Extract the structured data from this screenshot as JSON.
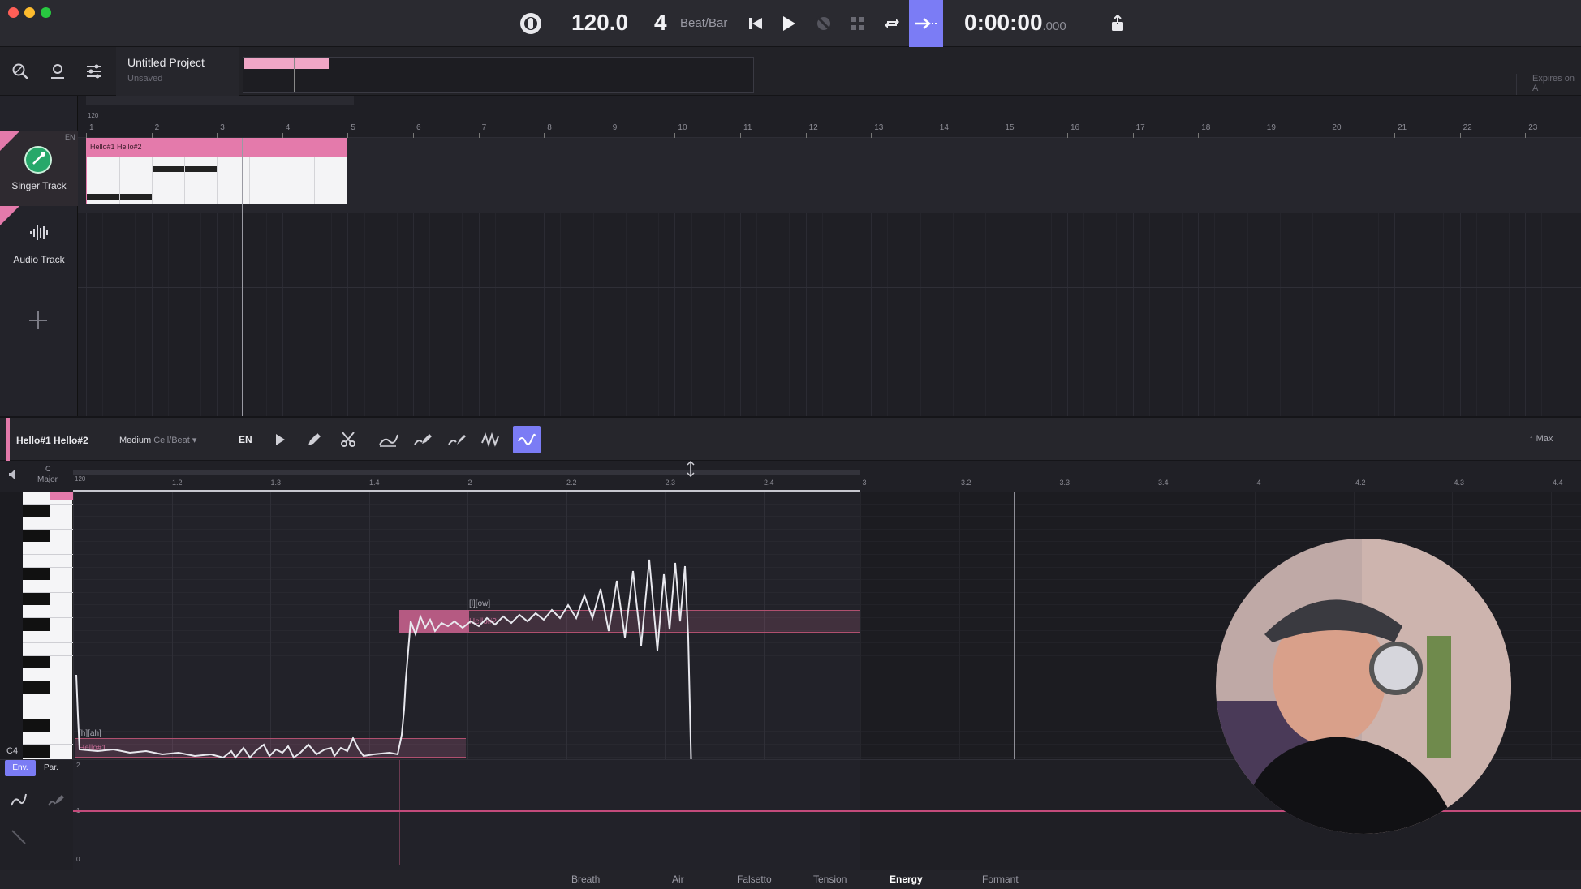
{
  "window": {
    "traffic_colors": [
      "#ff5f57",
      "#febc2e",
      "#28c840"
    ]
  },
  "transport": {
    "tempo": "120.0",
    "beats": "4",
    "beat_label": "Beat/Bar",
    "time_main": "0:00:00",
    "time_ms": ".000"
  },
  "project": {
    "title": "Untitled Project",
    "status": "Unsaved",
    "expires_label": "Expires on A"
  },
  "tracks": [
    {
      "name": "Singer Track",
      "lang": "EN"
    },
    {
      "name": "Audio Track"
    }
  ],
  "arrange": {
    "ruler_start": "120",
    "bars": [
      "1",
      "2",
      "3",
      "4",
      "5",
      "6",
      "7",
      "8",
      "9",
      "10",
      "11",
      "12",
      "13",
      "14",
      "15",
      "16",
      "17",
      "18",
      "19",
      "20",
      "21",
      "22",
      "23"
    ],
    "clip_label": "Hello#1 Hello#2"
  },
  "editor": {
    "clip_name": "Hello#1 Hello#2",
    "quantize": "Medium",
    "quantize_unit": "Cell/Beat",
    "lang": "EN",
    "max_label": "Max",
    "key": "C",
    "scale": "Major",
    "ruler_tempo": "120",
    "ruler_marks": [
      "1.2",
      "1.3",
      "1.4",
      "2",
      "2.2",
      "2.3",
      "2.4",
      "3",
      "3.2",
      "3.3",
      "3.4",
      "4",
      "4.2",
      "4.3",
      "4.4"
    ],
    "c4_label": "C4",
    "note1_phoneme": "[h][ah]",
    "note1_lyric": "Hello#1",
    "note2_phoneme": "[l][ow]",
    "note2_lyric": "Hello#2"
  },
  "param": {
    "tabs": [
      "Env.",
      "Par."
    ],
    "top_label": "2",
    "mid_label": "1",
    "bottom_label": "0",
    "bottom_tabs": [
      "Breath",
      "Air",
      "Falsetto",
      "Tension",
      "Energy",
      "Formant"
    ],
    "active_tab": "Energy"
  },
  "colors": {
    "accent": "#7b7cf5",
    "pink": "#e47aab",
    "pink_light": "#f0a6c6",
    "track_green": "#27a86a"
  }
}
